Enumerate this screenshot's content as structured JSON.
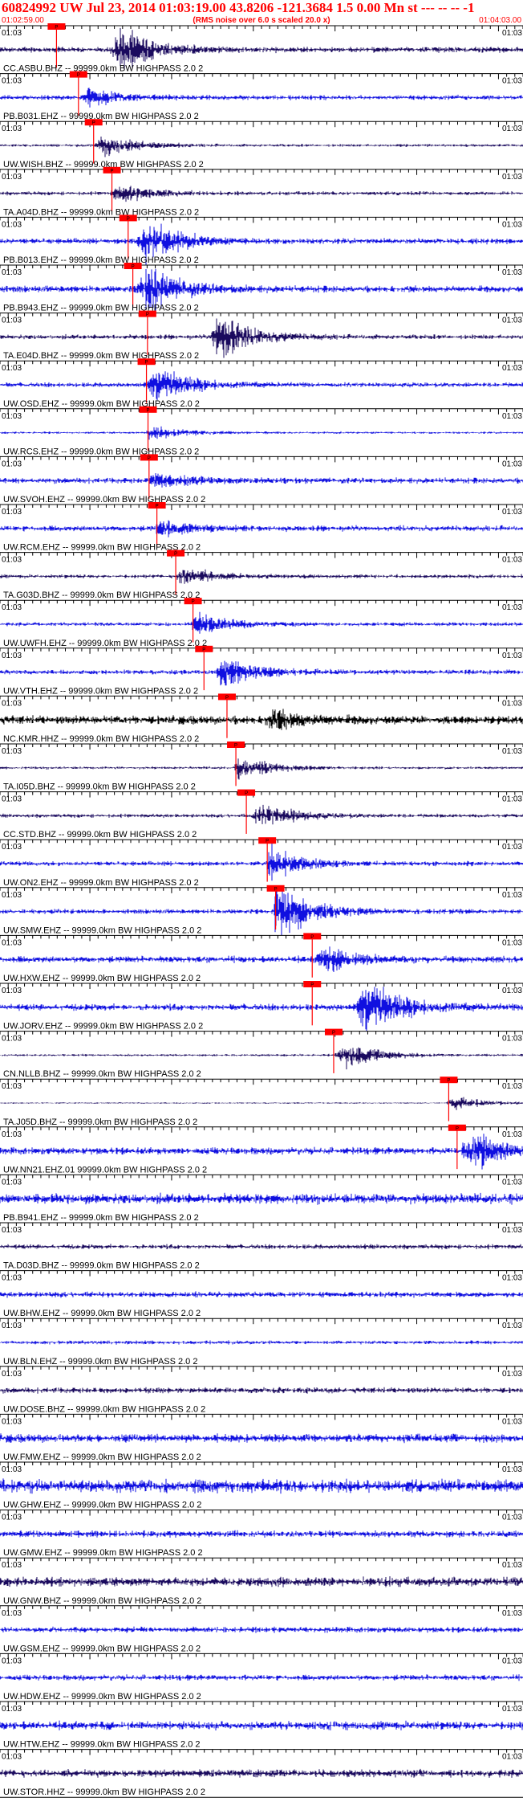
{
  "header": {
    "title": "60824992 UW Jul 23, 2014 01:03:19.00   43.8206 -121.3684  1.5 0.00 Mn st --- -- --  -1",
    "subtitle": "(RMS noise over 6.0 s scaled 20.0 x)",
    "start_time": "01:02:59.00",
    "end_time": "01:04:03.00"
  },
  "tick_label": "01:03",
  "colors": {
    "header_text": "#ff0000",
    "pick_box": "#ff0000",
    "pick_line": "#ff0000",
    "label_text": "#000000",
    "trace_navy": "#1a0a5e",
    "trace_blue": "#1010e0",
    "trace_black": "#000000",
    "axis": "#000000"
  },
  "pick_text": "P",
  "traces": [
    {
      "label": "CC.ASBU.BHZ -- 99999.0km BW  HIGHPASS  2.0  2",
      "color": "navy",
      "pick": 0.108,
      "burst": 0.23,
      "amp": 0.9,
      "noise": 0.12
    },
    {
      "label": "PB.B031.EHZ -- 99999.0km BW  HIGHPASS  2.0  2",
      "color": "blue",
      "pick": 0.15,
      "burst": 0.17,
      "amp": 0.35,
      "noise": 0.1
    },
    {
      "label": "UW.WISH.BHZ -- 99999.0km BW  HIGHPASS  2.0  2",
      "color": "navy",
      "pick": 0.179,
      "burst": 0.2,
      "amp": 0.45,
      "noise": 0.06
    },
    {
      "label": "TA.A04D.BHZ -- 99999.0km BW  HIGHPASS  2.0  2",
      "color": "navy",
      "pick": 0.214,
      "burst": 0.23,
      "amp": 0.35,
      "noise": 0.08
    },
    {
      "label": "PB.B013.EHZ -- 99999.0km BW  HIGHPASS  2.0  2",
      "color": "blue",
      "pick": 0.245,
      "burst": 0.28,
      "amp": 0.85,
      "noise": 0.12
    },
    {
      "label": "PB.B943.EHZ -- 99999.0km BW  HIGHPASS  2.0  2",
      "color": "blue",
      "pick": 0.254,
      "burst": 0.28,
      "amp": 0.9,
      "noise": 0.14
    },
    {
      "label": "TA.E04D.BHZ -- 99999.0km BW  HIGHPASS  2.0  2",
      "color": "navy",
      "pick": 0.282,
      "burst": 0.42,
      "amp": 0.95,
      "noise": 0.1
    },
    {
      "label": "UW.OSD.EHZ -- 99999.0km BW  HIGHPASS  2.0  2",
      "color": "blue",
      "pick": 0.28,
      "burst": 0.3,
      "amp": 0.7,
      "noise": 0.1
    },
    {
      "label": "UW.RCS.EHZ -- 99999.0km BW  HIGHPASS  2.0  2",
      "color": "blue",
      "pick": 0.283,
      "burst": 0.29,
      "amp": 0.3,
      "noise": 0.05
    },
    {
      "label": "UW.SVOH.EHZ -- 99999.0km BW  HIGHPASS  2.0  2",
      "color": "blue",
      "pick": 0.285,
      "burst": 0.3,
      "amp": 0.3,
      "noise": 0.12
    },
    {
      "label": "UW.RCM.EHZ -- 99999.0km BW  HIGHPASS  2.0  2",
      "color": "blue",
      "pick": 0.3,
      "burst": 0.31,
      "amp": 0.3,
      "noise": 0.12
    },
    {
      "label": "TA.G03D.BHZ -- 99999.0km BW  HIGHPASS  2.0  2",
      "color": "navy",
      "pick": 0.336,
      "burst": 0.35,
      "amp": 0.35,
      "noise": 0.08
    },
    {
      "label": "UW.UWFH.EHZ -- 99999.0km BW  HIGHPASS  2.0  2",
      "color": "blue",
      "pick": 0.369,
      "burst": 0.38,
      "amp": 0.45,
      "noise": 0.08
    },
    {
      "label": "UW.VTH.EHZ -- 99999.0km BW  HIGHPASS  2.0  2",
      "color": "blue",
      "pick": 0.39,
      "burst": 0.43,
      "amp": 0.65,
      "noise": 0.1
    },
    {
      "label": "NC.KMR.HHZ -- 99999.0km BW  HIGHPASS  2.0  2",
      "color": "black",
      "pick": 0.434,
      "burst": 0.52,
      "amp": 0.4,
      "noise": 0.18
    },
    {
      "label": "TA.I05D.BHZ -- 99999.0km BW  HIGHPASS  2.0  2",
      "color": "navy",
      "pick": 0.451,
      "burst": 0.46,
      "amp": 0.45,
      "noise": 0.06
    },
    {
      "label": "CC.STD.BHZ -- 99999.0km BW  HIGHPASS  2.0  2",
      "color": "navy",
      "pick": 0.471,
      "burst": 0.5,
      "amp": 0.5,
      "noise": 0.08
    },
    {
      "label": "UW.ON2.EHZ -- 99999.0km BW  HIGHPASS  2.0  2",
      "color": "blue",
      "pick": 0.511,
      "burst": 0.52,
      "amp": 0.6,
      "noise": 0.1
    },
    {
      "label": "UW.SMW.EHZ -- 99999.0km BW  HIGHPASS  2.0  2",
      "color": "blue",
      "pick": 0.527,
      "burst": 0.53,
      "amp": 1.2,
      "noise": 0.1
    },
    {
      "label": "UW.HXW.EHZ -- 99999.0km BW  HIGHPASS  2.0  2",
      "color": "blue",
      "pick": 0.597,
      "burst": 0.62,
      "amp": 0.5,
      "noise": 0.14
    },
    {
      "label": "UW.JORV.EHZ -- 99999.0km BW  HIGHPASS  2.0  2",
      "color": "blue",
      "pick": 0.597,
      "burst": 0.7,
      "amp": 1.1,
      "noise": 0.14
    },
    {
      "label": "CN.NLLB.BHZ -- 99999.0km BW  HIGHPASS  2.0  2",
      "color": "navy",
      "pick": 0.638,
      "burst": 0.66,
      "amp": 0.55,
      "noise": 0.05
    },
    {
      "label": "TA.J05D.BHZ -- 99999.0km BW  HIGHPASS  2.0  2",
      "color": "navy",
      "pick": 0.858,
      "burst": 0.87,
      "amp": 0.25,
      "noise": 0.03
    },
    {
      "label": "UW.NN21.EHZ.01 99999.0km BW  HIGHPASS  2.0  2",
      "color": "blue",
      "pick": 0.874,
      "burst": 0.9,
      "amp": 0.8,
      "noise": 0.15
    },
    {
      "label": "PB.B941.EHZ -- 99999.0km BW  HIGHPASS  2.0  2",
      "color": "blue",
      "pick": null,
      "burst": null,
      "amp": 0,
      "noise": 0.22
    },
    {
      "label": "TA.D03D.BHZ -- 99999.0km BW  HIGHPASS  2.0  2",
      "color": "navy",
      "pick": null,
      "burst": null,
      "amp": 0,
      "noise": 0.1
    },
    {
      "label": "UW.BHW.EHZ -- 99999.0km BW  HIGHPASS  2.0  2",
      "color": "blue",
      "pick": null,
      "burst": null,
      "amp": 0,
      "noise": 0.12
    },
    {
      "label": "UW.BLN.EHZ -- 99999.0km BW  HIGHPASS  2.0  2",
      "color": "blue",
      "pick": null,
      "burst": null,
      "amp": 0,
      "noise": 0.08
    },
    {
      "label": "UW.DOSE.BHZ -- 99999.0km BW  HIGHPASS  2.0  2",
      "color": "navy",
      "pick": null,
      "burst": null,
      "amp": 0,
      "noise": 0.12
    },
    {
      "label": "UW.FMW.EHZ -- 99999.0km BW  HIGHPASS  2.0  2",
      "color": "blue",
      "pick": null,
      "burst": null,
      "amp": 0,
      "noise": 0.18
    },
    {
      "label": "UW.GHW.EHZ -- 99999.0km BW  HIGHPASS  2.0  2",
      "color": "blue",
      "pick": null,
      "burst": null,
      "amp": 0,
      "noise": 0.28
    },
    {
      "label": "UW.GMW.EHZ -- 99999.0km BW  HIGHPASS  2.0  2",
      "color": "blue",
      "pick": null,
      "burst": null,
      "amp": 0,
      "noise": 0.14
    },
    {
      "label": "UW.GNW.BHZ -- 99999.0km BW  HIGHPASS  2.0  2",
      "color": "navy",
      "pick": null,
      "burst": null,
      "amp": 0,
      "noise": 0.2
    },
    {
      "label": "UW.GSM.EHZ -- 99999.0km BW  HIGHPASS  2.0  2",
      "color": "blue",
      "pick": null,
      "burst": null,
      "amp": 0,
      "noise": 0.12
    },
    {
      "label": "UW.HDW.EHZ -- 99999.0km BW  HIGHPASS  2.0  2",
      "color": "blue",
      "pick": null,
      "burst": null,
      "amp": 0,
      "noise": 0.12
    },
    {
      "label": "UW.HTW.EHZ -- 99999.0km BW  HIGHPASS  2.0  2",
      "color": "blue",
      "pick": null,
      "burst": null,
      "amp": 0,
      "noise": 0.18
    },
    {
      "label": "UW.STOR.HHZ -- 99999.0km BW  HIGHPASS  2.0  2",
      "color": "navy",
      "pick": null,
      "burst": null,
      "amp": 0,
      "noise": 0.16
    }
  ]
}
